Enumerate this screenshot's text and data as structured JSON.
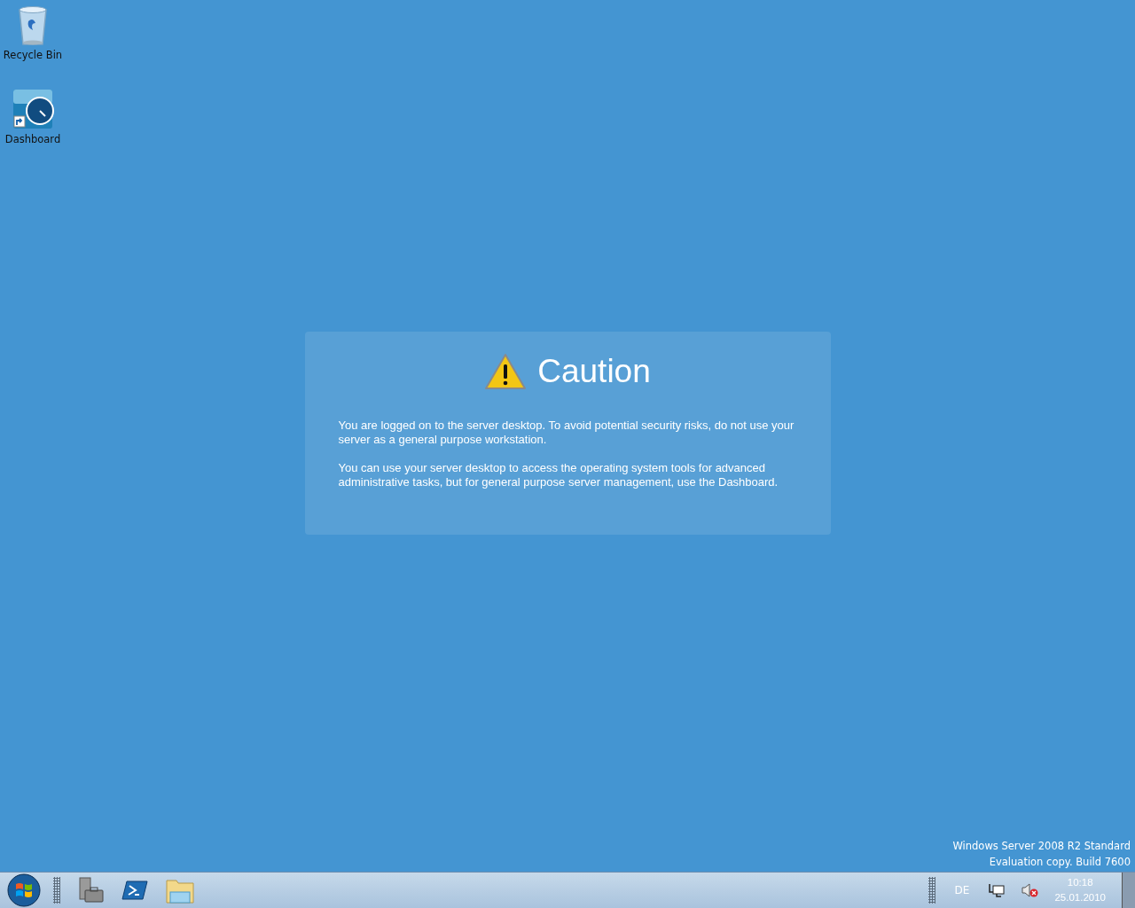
{
  "desktop_icons": [
    {
      "kind": "recycle-bin",
      "label": "Recycle Bin"
    },
    {
      "kind": "dashboard",
      "label": "Dashboard"
    }
  ],
  "caution": {
    "title": "Caution",
    "paragraphs": [
      "You are logged on to the server desktop. To avoid potential security risks, do not use your server as a general purpose workstation.",
      "You can use your server desktop to access the operating system tools for advanced administrative tasks, but for general purpose server management, use the Dashboard."
    ]
  },
  "edition": [
    "Windows Server 2008 R2 Standard",
    "Evaluation copy. Build 7600"
  ],
  "taskbar": {
    "pinned": [
      {
        "kind": "server-manager"
      },
      {
        "kind": "powershell"
      },
      {
        "kind": "explorer"
      }
    ],
    "tray": {
      "language": "DE",
      "volume_muted": true,
      "time": "10:18",
      "date": "25.01.2010"
    }
  }
}
